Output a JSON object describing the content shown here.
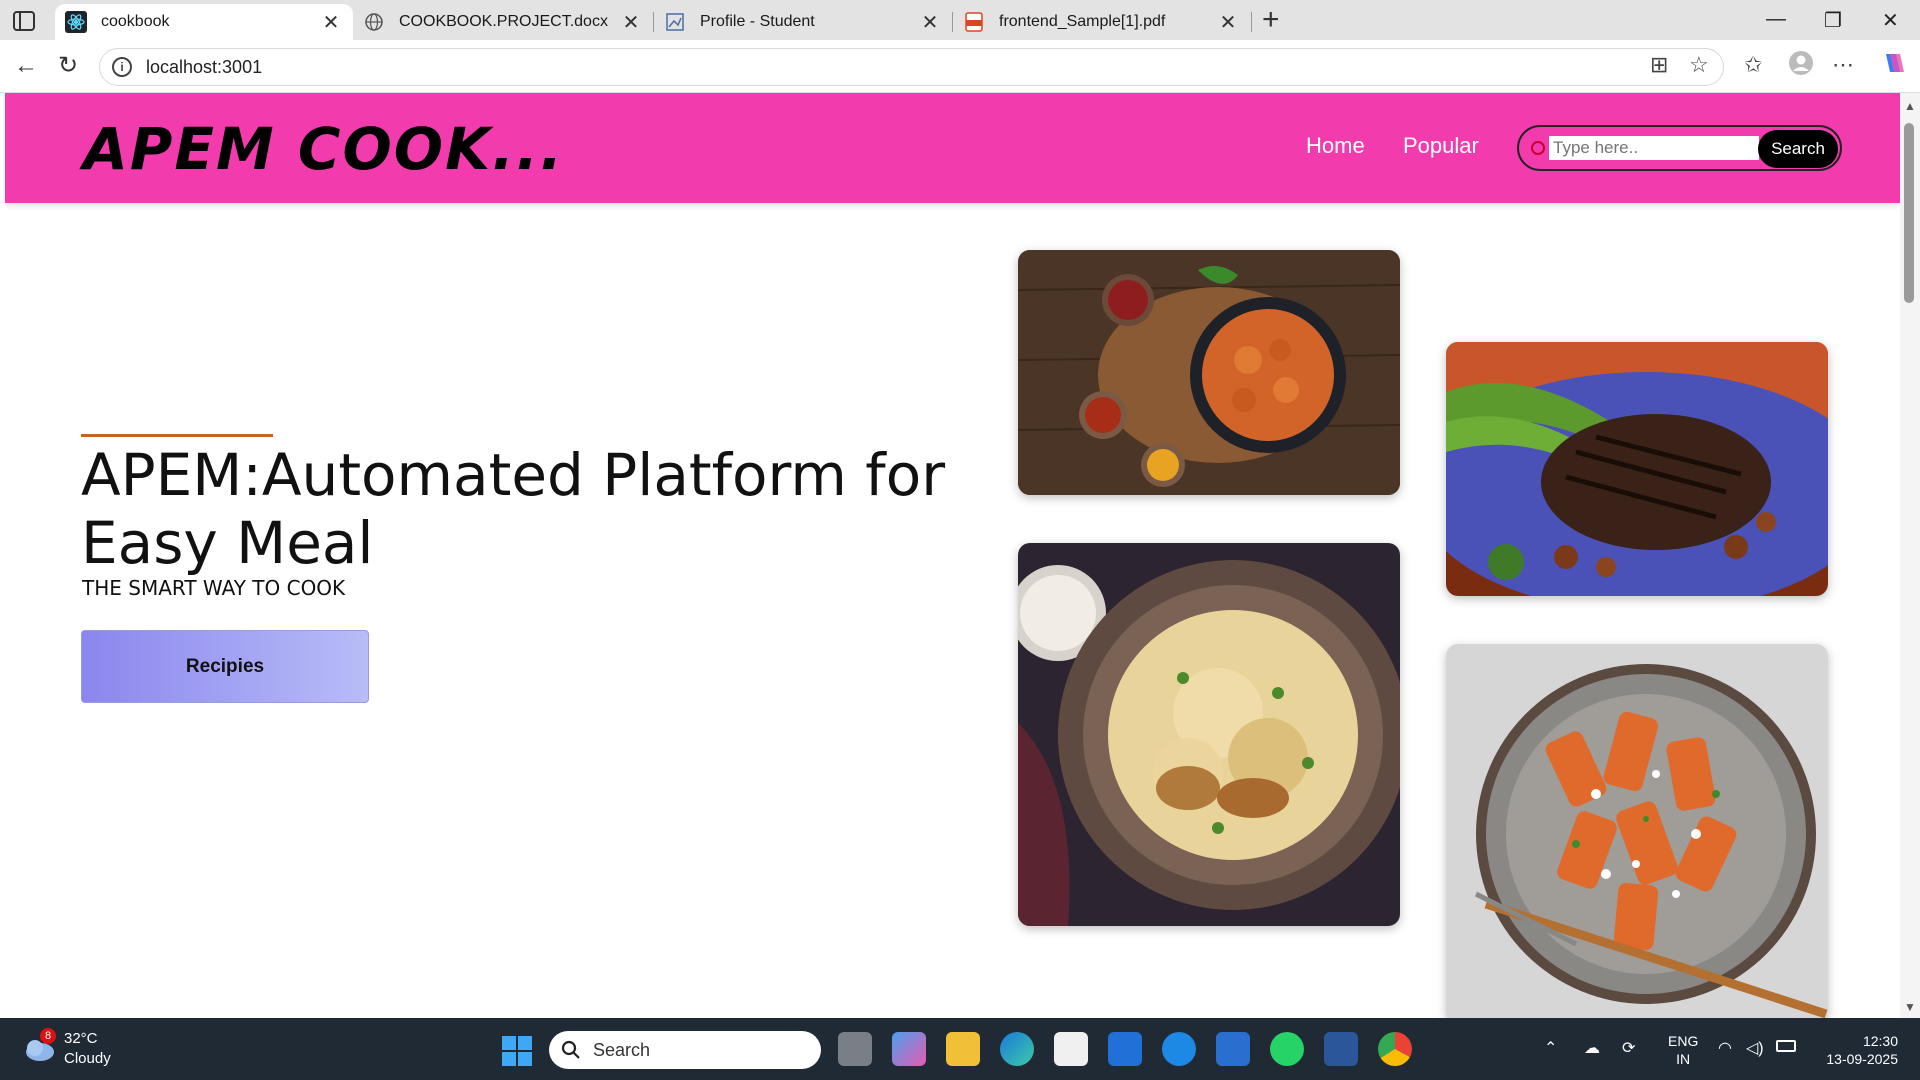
{
  "browser": {
    "tabs": [
      {
        "title": "cookbook",
        "icon": "react-icon",
        "active": true
      },
      {
        "title": "COOKBOOK.PROJECT.docx",
        "icon": "globe-icon",
        "active": false
      },
      {
        "title": "Profile - Student",
        "icon": "profile-icon",
        "active": false
      },
      {
        "title": "frontend_Sample[1].pdf",
        "icon": "pdf-icon",
        "active": false
      }
    ],
    "url": "localhost:3001"
  },
  "site": {
    "logo": "APEM COOK...",
    "nav": [
      "Home",
      "Popular"
    ],
    "search_placeholder": "Type here..",
    "search_button": "Search",
    "brand_color": "#f23bac"
  },
  "hero": {
    "heading": "APEM:Automated Platform for Easy Meal",
    "subheading": "THE SMART WAY TO COOK",
    "button": "Recipies"
  },
  "food_images": [
    {
      "name": "butter-chicken-image"
    },
    {
      "name": "steak-image"
    },
    {
      "name": "biryani-image"
    },
    {
      "name": "pasta-image"
    }
  ],
  "taskbar": {
    "weather_temp": "32°C",
    "weather_desc": "Cloudy",
    "notification_count": "8",
    "search_label": "Search",
    "lang_line1": "ENG",
    "lang_line2": "IN",
    "time": "12:30",
    "date": "13-09-2025"
  }
}
